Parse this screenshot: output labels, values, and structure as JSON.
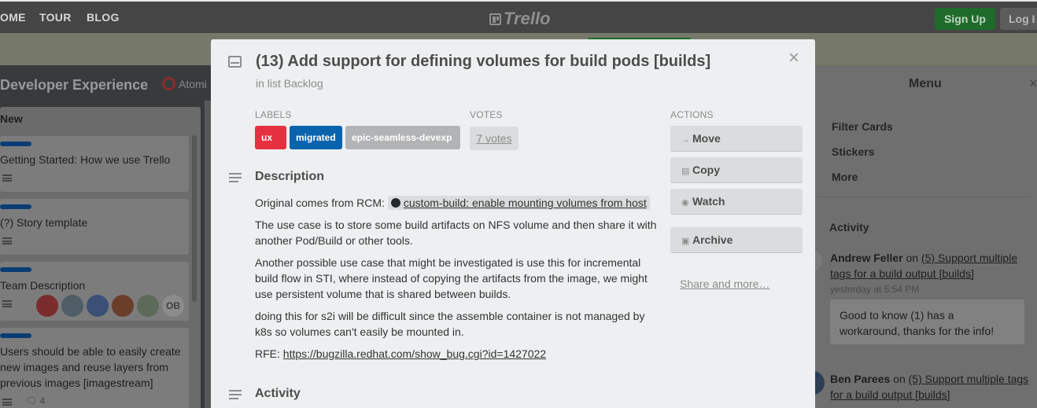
{
  "topbar": {
    "nav": [
      "OME",
      "TOUR",
      "BLOG"
    ],
    "logo": "Trello",
    "signup_label": "Sign Up",
    "login_label": "Log I"
  },
  "board": {
    "title": "Developer Experience",
    "org": "Atomi",
    "list_title": "New",
    "cards": [
      {
        "text": "Getting Started: How we use Trello"
      },
      {
        "text": "(?) Story template"
      },
      {
        "text": "Team Description",
        "avatar_extra": "OB"
      },
      {
        "text": "Users should be able to easily create new images and reuse layers from previous images [imagestream]",
        "comments": "4"
      }
    ]
  },
  "sidebar": {
    "title": "Menu",
    "close": "×",
    "items": [
      "Filter Cards",
      "Stickers",
      "More"
    ],
    "activity_title": "Activity",
    "activity": [
      {
        "author": "Andrew Feller",
        "verb": "on",
        "link": "(5) Support multiple tags for a build output [builds]",
        "time": "yesterday at 5:54 PM",
        "comment": "Good to know (1) has a workaround, thanks for the info!"
      },
      {
        "author": "Ben Parees",
        "verb": "on",
        "link": "(5) Support multiple tags for a build output [builds]"
      }
    ]
  },
  "modal": {
    "title": "(13) Add support for defining volumes for build pods [builds]",
    "in_list_prefix": "in list",
    "in_list": "Backlog",
    "close": "×",
    "labels_heading": "LABELS",
    "labels": [
      {
        "text": "ux",
        "color": "#e5303f"
      },
      {
        "text": "migrated",
        "color": "#0a63ad"
      },
      {
        "text": "epic-seamless-devexp",
        "color": "#b2b3b5"
      }
    ],
    "votes_heading": "VOTES",
    "votes": "7 votes",
    "description_heading": "Description",
    "description": {
      "p1_prefix": "Original comes from RCM:",
      "p1_link": "custom-build: enable mounting volumes from host",
      "p2": "The use case is to store some build artifacts on NFS volume and then share it with another Pod/Build or other tools.",
      "p3": "Another possible use case that might be investigated is use this for incremental build flow in STI, where instead of copying the artifacts from the image, we might use persistent volume that is shared between builds.",
      "p4": "doing this for s2i will be difficult since the assemble container is not managed by k8s so volumes can't easily be mounted in.",
      "p5_prefix": "RFE:",
      "p5_link": "https://bugzilla.redhat.com/show_bug.cgi?id=1427022"
    },
    "activity_heading": "Activity",
    "actions_heading": "ACTIONS",
    "actions": [
      {
        "label": "Move",
        "icon": "arrow-right-icon"
      },
      {
        "label": "Copy",
        "icon": "copy-icon"
      },
      {
        "label": "Watch",
        "icon": "eye-icon"
      },
      {
        "label": "Archive",
        "icon": "archive-icon"
      }
    ],
    "share": "Share and more…"
  }
}
